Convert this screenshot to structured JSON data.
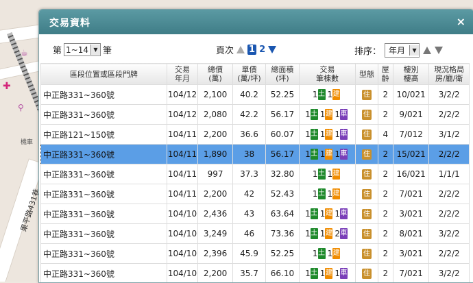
{
  "map": {
    "road_label": "果平路431巷",
    "small_label": "機車"
  },
  "dialog": {
    "title": "交易資料",
    "close_glyph": "×"
  },
  "pager": {
    "prefix": "第",
    "range_value": "1~14",
    "suffix": "筆",
    "page_label": "頁次",
    "current_page": "1",
    "next_page": "2"
  },
  "sort": {
    "label": "排序：",
    "value": "年月"
  },
  "table": {
    "headers": {
      "address": "區段位置或區段門牌",
      "ym": "交易\n年月",
      "total": "總價\n(萬)",
      "unit": "單價\n(萬/坪)",
      "area": "總面積\n(坪)",
      "count": "交易\n筆棟數",
      "type": "型態",
      "age": "屋\n齡",
      "floor": "樓別\n樓高",
      "layout": "現況格局\n房/廳/衛"
    },
    "rows": [
      {
        "address": "中正路331~360號",
        "ym": "104/12",
        "total": "2,100",
        "unit": "40.2",
        "area": "52.25",
        "land": "1",
        "build": "1",
        "car": "",
        "type": "住",
        "age": "2",
        "floor": "10/021",
        "layout": "3/2/2"
      },
      {
        "address": "中正路331~360號",
        "ym": "104/12",
        "total": "2,080",
        "unit": "42.2",
        "area": "56.17",
        "land": "1",
        "build": "1",
        "car": "1",
        "type": "住",
        "age": "2",
        "floor": "9/021",
        "layout": "2/2/2"
      },
      {
        "address": "中正路121~150號",
        "ym": "104/11",
        "total": "2,200",
        "unit": "36.6",
        "area": "60.07",
        "land": "1",
        "build": "1",
        "car": "1",
        "type": "住",
        "age": "4",
        "floor": "7/012",
        "layout": "3/1/2"
      },
      {
        "address": "中正路331~360號",
        "ym": "104/11",
        "total": "1,890",
        "unit": "38",
        "area": "56.17",
        "land": "1",
        "build": "1",
        "car": "1",
        "type": "住",
        "age": "2",
        "floor": "15/021",
        "layout": "2/2/2",
        "selected": true
      },
      {
        "address": "中正路331~360號",
        "ym": "104/11",
        "total": "997",
        "unit": "37.3",
        "area": "32.80",
        "land": "1",
        "build": "1",
        "car": "",
        "type": "住",
        "age": "2",
        "floor": "16/021",
        "layout": "1/1/1"
      },
      {
        "address": "中正路331~360號",
        "ym": "104/11",
        "total": "2,200",
        "unit": "42",
        "area": "52.43",
        "land": "1",
        "build": "1",
        "car": "",
        "type": "住",
        "age": "2",
        "floor": "7/021",
        "layout": "2/2/2"
      },
      {
        "address": "中正路331~360號",
        "ym": "104/10",
        "total": "2,436",
        "unit": "43",
        "area": "63.64",
        "land": "1",
        "build": "1",
        "car": "1",
        "type": "住",
        "age": "2",
        "floor": "3/021",
        "layout": "2/2/2"
      },
      {
        "address": "中正路331~360號",
        "ym": "104/10",
        "total": "3,249",
        "unit": "46",
        "area": "73.36",
        "land": "1",
        "build": "1",
        "car": "2",
        "type": "住",
        "age": "2",
        "floor": "8/021",
        "layout": "3/2/2"
      },
      {
        "address": "中正路331~360號",
        "ym": "104/10",
        "total": "2,396",
        "unit": "45.9",
        "area": "52.25",
        "land": "1",
        "build": "1",
        "car": "",
        "type": "住",
        "age": "2",
        "floor": "3/021",
        "layout": "2/2/2"
      },
      {
        "address": "中正路331~360號",
        "ym": "104/10",
        "total": "2,200",
        "unit": "35.7",
        "area": "66.10",
        "land": "1",
        "build": "1",
        "car": "1",
        "type": "住",
        "age": "2",
        "floor": "7/021",
        "layout": "3/2/2"
      }
    ],
    "tags": {
      "land": "土",
      "build": "建",
      "car": "車"
    }
  },
  "colors": {
    "header": "#4a8a93",
    "selected_row": "#5b9ee6",
    "land_tag": "#1f8a2c",
    "build_tag": "#f08c00",
    "car_tag": "#7a3fb8",
    "type_badge": "#c9902c"
  }
}
